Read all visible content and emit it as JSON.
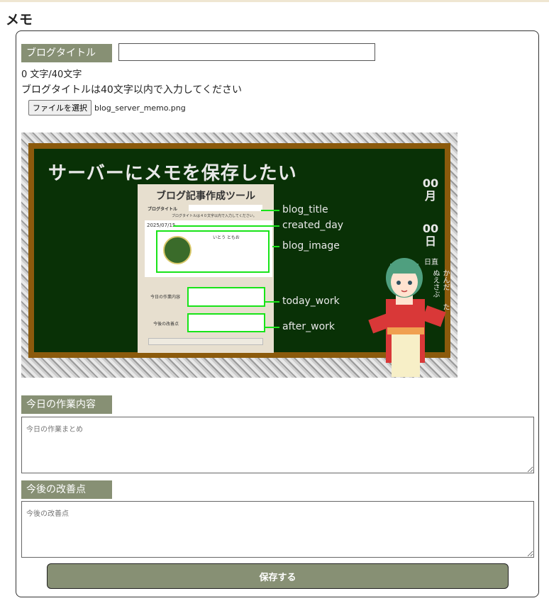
{
  "page": {
    "title": "メモ"
  },
  "form": {
    "blog_title_label": "ブログタイトル",
    "blog_title_value": "",
    "char_count": "0 文字/40文字",
    "title_hint": "ブログタイトルは40文字以内で入力してください",
    "file_button_label": "ファイルを選択",
    "file_name": "blog_server_memo.png",
    "today_work_label": "今日の作業内容",
    "today_work_placeholder": "今日の作業まとめ",
    "after_work_label": "今後の改善点",
    "after_work_placeholder": "今後の改善点",
    "save_label": "保存する"
  },
  "preview": {
    "headline": "サーバーにメモを保存したい",
    "mock_title": "ブログ記事作成ツール",
    "mock_title_label": "ブログタイトル",
    "mock_hint": "ブログタイトルは４０文字以内で入力してください。",
    "mock_date": "2025/07/15",
    "mock_author": "いとう ともお",
    "mock_today_label": "今日の作業内容",
    "mock_after_label": "今後の改善点",
    "tags": [
      "blog_title",
      "created_day",
      "blog_image",
      "today_work",
      "after_work"
    ],
    "month": [
      "00",
      "月"
    ],
    "day": [
      "00",
      "日"
    ],
    "weekday": "日直",
    "duty_names": [
      "かんだ",
      "ぬえさぶ",
      "た"
    ]
  },
  "colors": {
    "label_bg": "#879074",
    "board_green": "#093106",
    "board_frame": "#8b5a0c",
    "highlight": "#18e418"
  }
}
